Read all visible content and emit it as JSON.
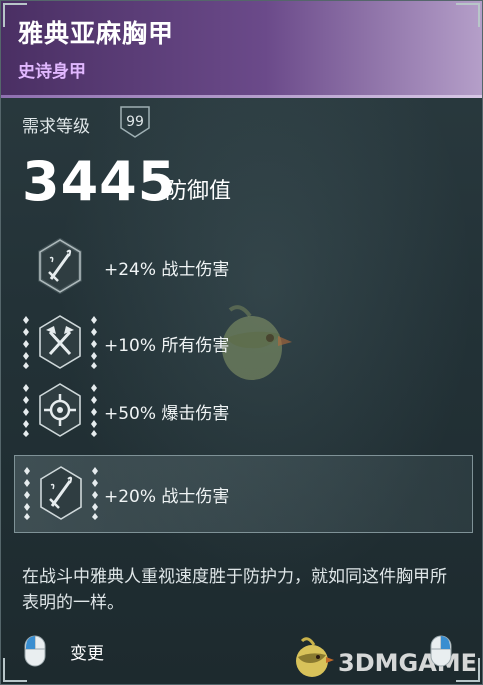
{
  "item": {
    "name": "雅典亚麻胸甲",
    "rarity": "史诗身甲"
  },
  "requirement": {
    "label": "需求等级",
    "level": "99"
  },
  "armor": {
    "value": "3445",
    "label": "防御值"
  },
  "perks": [
    {
      "text": "+24% 战士伤害",
      "icon": "sword-icon",
      "selected": false
    },
    {
      "text": "+10% 所有伤害",
      "icon": "crossed-axes-icon",
      "selected": false
    },
    {
      "text": "+50% 爆击伤害",
      "icon": "crosshair-icon",
      "selected": false
    },
    {
      "text": "+20% 战士伤害",
      "icon": "sword-icon",
      "selected": true
    }
  ],
  "description": "在战斗中雅典人重视速度胜于防护力，就如同这件胸甲所表明的一样。",
  "footer": {
    "action_label": "变更",
    "action_icon": "mouse-left-click-icon",
    "right_icon": "mouse-right-click-icon"
  },
  "watermark": {
    "text": "3DMGAME"
  },
  "colors": {
    "header_start": "#4a2f63",
    "header_end": "#b59fc9",
    "rarity": "#e1b8ff",
    "panel": "#233237"
  }
}
